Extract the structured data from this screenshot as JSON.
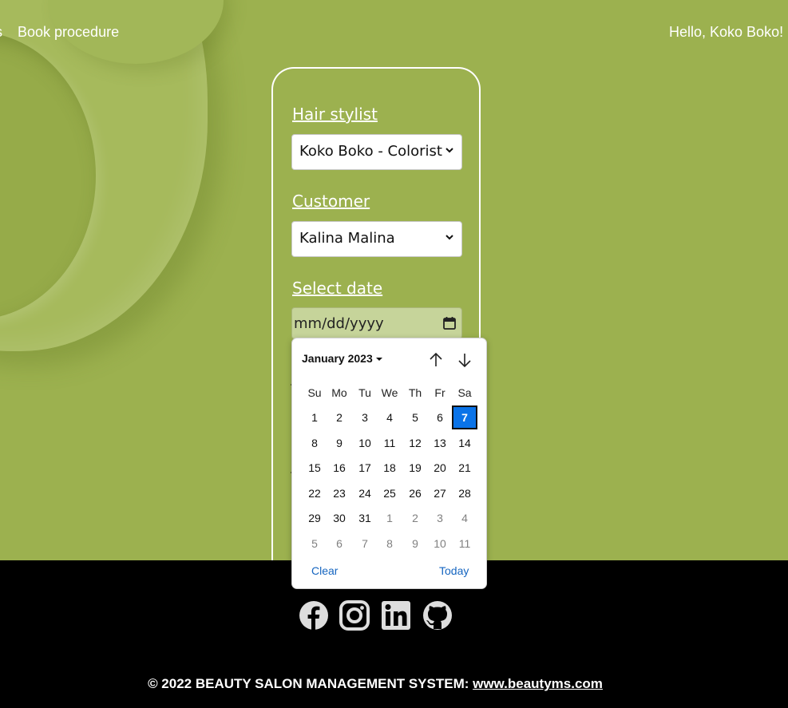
{
  "nav": {
    "left_fragment": "s",
    "book_procedure": "Book procedure",
    "greeting": "Hello, Koko Boko!"
  },
  "form": {
    "stylist_label": "Hair stylist",
    "stylist_value": "Koko Boko - Colorist",
    "customer_label": "Customer",
    "customer_value": "Kalina Malina",
    "date_label": "Select date",
    "date_placeholder": "mm/dd/yyyy"
  },
  "datepicker": {
    "month_label": "January 2023",
    "weekdays": [
      "Su",
      "Mo",
      "Tu",
      "We",
      "Th",
      "Fr",
      "Sa"
    ],
    "weeks": [
      [
        "1",
        "2",
        "3",
        "4",
        "5",
        "6",
        "7"
      ],
      [
        "8",
        "9",
        "10",
        "11",
        "12",
        "13",
        "14"
      ],
      [
        "15",
        "16",
        "17",
        "18",
        "19",
        "20",
        "21"
      ],
      [
        "22",
        "23",
        "24",
        "25",
        "26",
        "27",
        "28"
      ],
      [
        "29",
        "30",
        "31",
        "1",
        "2",
        "3",
        "4"
      ],
      [
        "5",
        "6",
        "7",
        "8",
        "9",
        "10",
        "11"
      ]
    ],
    "selected_day": "7",
    "clear_label": "Clear",
    "today_label": "Today",
    "selected_color": "#0a73e8"
  },
  "footer": {
    "copyright_text": "© 2022 BEAUTY SALON MANAGEMENT SYSTEM: ",
    "site_link": "www.beautyms.com",
    "social_icons": [
      "facebook-icon",
      "instagram-icon",
      "linkedin-icon",
      "github-icon"
    ]
  },
  "colors": {
    "background": "#9cb14f",
    "footer": "#000000",
    "accent": "#0a73e8"
  }
}
